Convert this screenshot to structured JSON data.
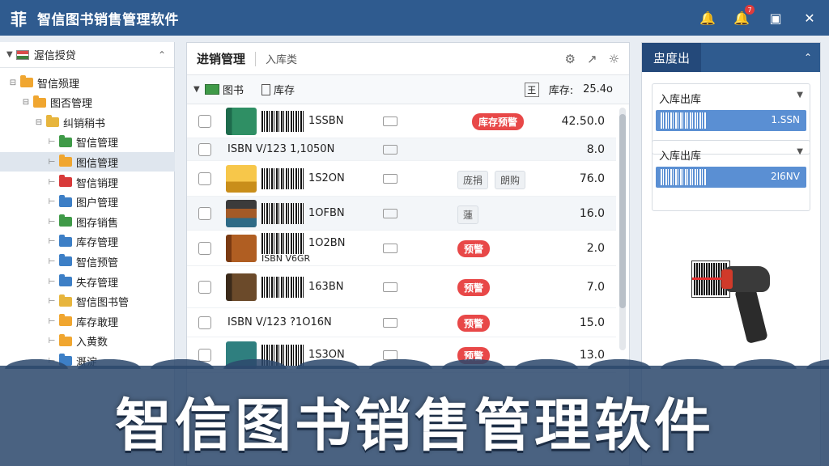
{
  "app": {
    "title": "智信图书销售管理软件",
    "logo_glyph": "菲"
  },
  "titlebar": {
    "notification_count": "7",
    "icons": [
      "bell-icon",
      "bell-badge-icon",
      "restore-icon",
      "close-icon"
    ]
  },
  "tree": {
    "root": "渥信授贷",
    "items": [
      {
        "label": "智信殒理",
        "icon": "folder",
        "color": "orange",
        "indent": 0,
        "twisty": "⊟"
      },
      {
        "label": "图否管理",
        "icon": "folder",
        "color": "orange",
        "indent": 1,
        "twisty": "⊟"
      },
      {
        "label": "纠销稍书",
        "icon": "folder",
        "color": "yellow",
        "indent": 2,
        "twisty": "⊟"
      },
      {
        "label": "智信管理",
        "icon": "folder",
        "color": "green",
        "indent": 3,
        "twisty": "⊢"
      },
      {
        "label": "图信管理",
        "icon": "folder",
        "color": "orange",
        "indent": 3,
        "twisty": "⊢",
        "selected": true
      },
      {
        "label": "智信销理",
        "icon": "folder",
        "color": "red",
        "indent": 3,
        "twisty": "⊢"
      },
      {
        "label": "图户管理",
        "icon": "folder",
        "color": "blue",
        "indent": 3,
        "twisty": "⊢"
      },
      {
        "label": "图存销售",
        "icon": "folder",
        "color": "green",
        "indent": 3,
        "twisty": "⊢"
      },
      {
        "label": "库存管理",
        "icon": "folder",
        "color": "blue",
        "indent": 3,
        "twisty": "⊢"
      },
      {
        "label": "智信预管",
        "icon": "folder",
        "color": "blue",
        "indent": 3,
        "twisty": "⊢"
      },
      {
        "label": "失存管理",
        "icon": "folder",
        "color": "blue",
        "indent": 3,
        "twisty": "⊢"
      },
      {
        "label": "智信图书管",
        "icon": "folder",
        "color": "yellow",
        "indent": 3,
        "twisty": "⊢"
      },
      {
        "label": "库存敢理",
        "icon": "folder",
        "color": "orange",
        "indent": 3,
        "twisty": "⊢"
      },
      {
        "label": "入黄数",
        "icon": "folder",
        "color": "orange",
        "indent": 3,
        "twisty": "⊢"
      },
      {
        "label": "溉淀",
        "icon": "folder",
        "color": "blue",
        "indent": 3,
        "twisty": "⊢"
      }
    ]
  },
  "center": {
    "title": "进销管理",
    "subtitle": "入库类",
    "tool_icons": [
      "gear-icon",
      "export-icon",
      "settings-icon"
    ],
    "grid_head": {
      "book_label": "图书",
      "doc_label": "库存",
      "stock_label": "库存:",
      "stock_value": "25.4o",
      "icon_text": "王"
    },
    "rows": [
      {
        "book": "green",
        "isbn": "1SSBN",
        "badge": "库存预警",
        "qty": "42.50.0",
        "alt": false,
        "layout": "barcode"
      },
      {
        "book": "",
        "isbn": "ISBN V/123  1,1050N",
        "badge": "",
        "qty": "8.0",
        "alt": true,
        "layout": "text"
      },
      {
        "book": "yellow",
        "isbn": "1S2ON",
        "chips": [
          "庞捐",
          "朗购"
        ],
        "qty": "76.0",
        "alt": false,
        "layout": "barcode"
      },
      {
        "book": "stack",
        "isbn": "1OFBN",
        "chips": [
          "蓮"
        ],
        "qty": "16.0",
        "alt": true,
        "layout": "barcode"
      },
      {
        "book": "brown",
        "isbn": "1O2BN",
        "sub": "ISBN V6GR",
        "badge": "预警",
        "qty": "2.0",
        "alt": false,
        "layout": "barcode"
      },
      {
        "book": "dark",
        "isbn": "163BN",
        "badge": "预警",
        "qty": "7.0",
        "alt": false,
        "layout": "barcode"
      },
      {
        "book": "",
        "isbn": "ISBN V/123  ?1O16N",
        "badge": "预警",
        "qty": "15.0",
        "alt": false,
        "layout": "text"
      },
      {
        "book": "teal",
        "isbn": "1S3ON",
        "badge": "预警",
        "qty": "13.0",
        "alt": false,
        "layout": "barcode"
      }
    ]
  },
  "right": {
    "tab": "盅度出",
    "boxes": [
      {
        "label": "入库出库",
        "value": "1.SSN"
      },
      {
        "label": "入库出库",
        "value": "2I6NV"
      }
    ]
  },
  "banner": {
    "text": "智信图书销售管理软件"
  }
}
